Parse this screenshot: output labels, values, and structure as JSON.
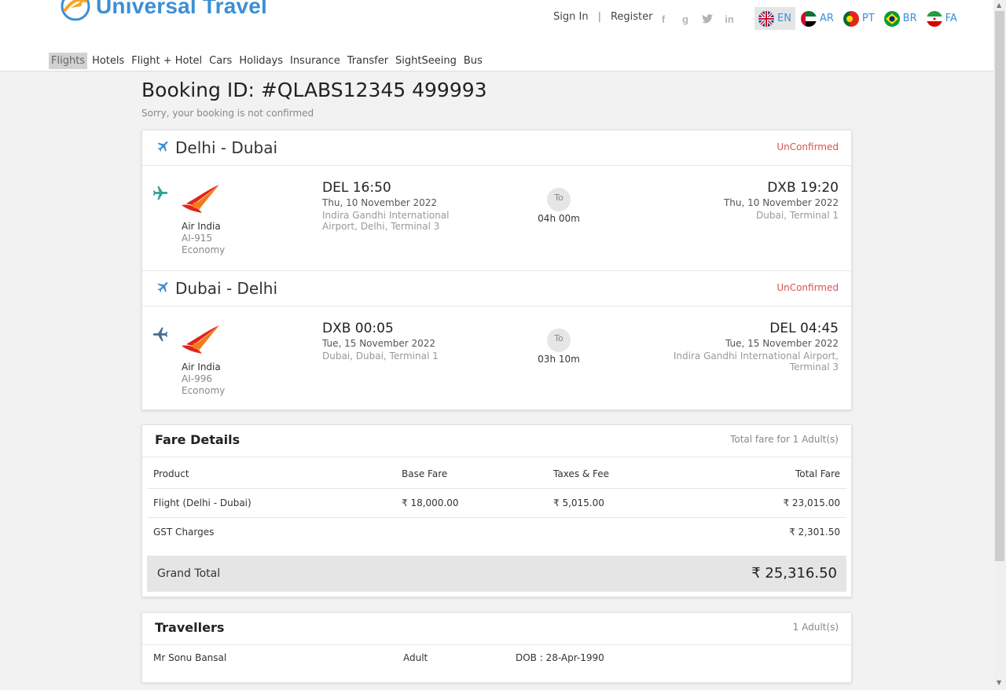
{
  "brand": {
    "name": "Universal Travel"
  },
  "auth": {
    "sign_in": "Sign In",
    "separator": "|",
    "register": "Register"
  },
  "social": [
    "facebook-icon",
    "google-icon",
    "twitter-icon",
    "linkedin-icon"
  ],
  "languages": [
    {
      "code": "EN",
      "flag": "uk-flag-icon",
      "active": true
    },
    {
      "code": "AR",
      "flag": "uae-flag-icon",
      "active": false
    },
    {
      "code": "PT",
      "flag": "portugal-flag-icon",
      "active": false
    },
    {
      "code": "BR",
      "flag": "brazil-flag-icon",
      "active": false
    },
    {
      "code": "FA",
      "flag": "iran-flag-icon",
      "active": false
    }
  ],
  "nav": [
    "Flights",
    "Hotels",
    "Flight + Hotel",
    "Cars",
    "Holidays",
    "Insurance",
    "Transfer",
    "SightSeeing",
    "Bus"
  ],
  "booking": {
    "title": "Booking ID: #QLABS12345 499993",
    "subtitle": "Sorry, your booking is not confirmed"
  },
  "segments": [
    {
      "route": "Delhi - Dubai",
      "status": "UnConfirmed",
      "airline": "Air India",
      "flight_no": "AI-915",
      "cabin": "Economy",
      "dep_time": "DEL 16:50",
      "dep_date": "Thu, 10 November 2022",
      "dep_place": "Indira Gandhi International Airport, Delhi, Terminal 3",
      "to_label": "To",
      "duration": "04h 00m",
      "arr_time": "DXB 19:20",
      "arr_date": "Thu, 10 November 2022",
      "arr_place": "Dubai, Terminal 1"
    },
    {
      "route": "Dubai - Delhi",
      "status": "UnConfirmed",
      "airline": "Air India",
      "flight_no": "AI-996",
      "cabin": "Economy",
      "dep_time": "DXB 00:05",
      "dep_date": "Tue, 15 November 2022",
      "dep_place": "Dubai, Dubai, Terminal 1",
      "to_label": "To",
      "duration": "03h 10m",
      "arr_time": "DEL 04:45",
      "arr_date": "Tue, 15 November 2022",
      "arr_place": "Indira Gandhi International Airport, Terminal 3"
    }
  ],
  "fare": {
    "title": "Fare Details",
    "meta": "Total fare for 1 Adult(s)",
    "headers": [
      "Product",
      "Base Fare",
      "Taxes & Fee",
      "Total Fare"
    ],
    "rows": [
      [
        "Flight (Delhi - Dubai)",
        "₹ 18,000.00",
        "₹ 5,015.00",
        "₹ 23,015.00"
      ],
      [
        "GST Charges",
        "",
        "",
        "₹ 2,301.50"
      ]
    ],
    "grand_label": "Grand Total",
    "grand_value": "₹ 25,316.50"
  },
  "travellers": {
    "title": "Travellers",
    "meta": "1 Adult(s)",
    "rows": [
      {
        "name": "Mr Sonu Bansal",
        "type": "Adult",
        "dob": "DOB : 28-Apr-1990"
      }
    ]
  },
  "colors": {
    "accent": "#3b8fd6",
    "status": "#d9534f",
    "outbound": "#2aa38d",
    "inbound": "#4a6d8c"
  }
}
